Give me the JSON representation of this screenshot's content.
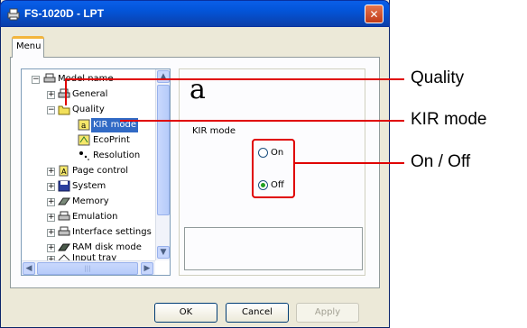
{
  "window": {
    "title": "FS-1020D - LPT",
    "close_glyph": "✕"
  },
  "tabs": [
    {
      "label": "Menu"
    }
  ],
  "tree": {
    "items": [
      {
        "label": "Model name",
        "icon": "printer-icon",
        "expander": "−"
      },
      {
        "label": "General",
        "icon": "printer-icon",
        "expander": "+"
      },
      {
        "label": "Quality",
        "icon": "quality-folder-icon",
        "expander": "−"
      },
      {
        "label": "KIR mode",
        "icon": "kir-icon",
        "selected": true
      },
      {
        "label": "EcoPrint",
        "icon": "ecoprint-icon"
      },
      {
        "label": "Resolution",
        "icon": "resolution-icon"
      },
      {
        "label": "Page control",
        "icon": "page-control-icon",
        "expander": "+"
      },
      {
        "label": "System",
        "icon": "floppy-disk-icon",
        "expander": "+"
      },
      {
        "label": "Memory",
        "icon": "memory-icon",
        "expander": "+"
      },
      {
        "label": "Emulation",
        "icon": "printer-icon",
        "expander": "+"
      },
      {
        "label": "Interface settings",
        "icon": "printer-icon",
        "expander": "+"
      },
      {
        "label": "RAM disk mode",
        "icon": "ram-disk-icon",
        "expander": "+"
      },
      {
        "label": "Input tray",
        "icon": "input-tray-icon",
        "expander": "+"
      }
    ]
  },
  "detail": {
    "preview_glyph": "a",
    "setting_label": "KIR mode",
    "options": [
      {
        "label": "On",
        "checked": false
      },
      {
        "label": "Off",
        "checked": true
      }
    ]
  },
  "buttons": {
    "ok": "OK",
    "cancel": "Cancel",
    "apply": "Apply"
  },
  "callouts": {
    "quality": "Quality",
    "kir_mode": "KIR mode",
    "on_off": "On / Off"
  },
  "colors": {
    "callout": "#e00000",
    "selection": "#316ac5",
    "titlebar": "#0354d8"
  }
}
